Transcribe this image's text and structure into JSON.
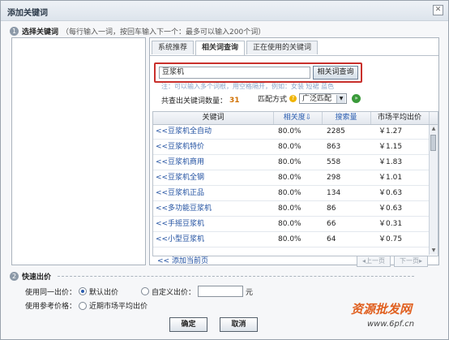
{
  "dialog": {
    "title": "添加关键词",
    "close_glyph": "✕"
  },
  "section1": {
    "number": "1",
    "title": "选择关键词",
    "note": "（每行输入一词，按回车输入下一个：最多可以输入200个词）"
  },
  "tabs": [
    {
      "label": "系统推荐"
    },
    {
      "label": "相关词查询"
    },
    {
      "label": "正在使用的关键词"
    }
  ],
  "search": {
    "value": "豆浆机",
    "button": "相关词查询"
  },
  "hint": "注：可以输入多个词根，用空格隔开，例如：女装  短裙  蓝色",
  "result": {
    "label": "共查出关键词数量：",
    "count": "31"
  },
  "match": {
    "label": "匹配方式",
    "help_glyph": "?",
    "selected": "广泛匹配",
    "go_glyph": "»"
  },
  "grid": {
    "headers": {
      "keyword": "关键词",
      "relevance": "相关度",
      "sort_glyph": "⇩",
      "searches": "搜索量",
      "price": "市场平均出价"
    },
    "rows": [
      {
        "kw": "豆浆机全自动",
        "rel": "80.0%",
        "sea": "2285",
        "price": "￥1.27"
      },
      {
        "kw": "豆浆机特价",
        "rel": "80.0%",
        "sea": "863",
        "price": "￥1.15"
      },
      {
        "kw": "豆浆机商用",
        "rel": "80.0%",
        "sea": "558",
        "price": "￥1.83"
      },
      {
        "kw": "豆浆机全钢",
        "rel": "80.0%",
        "sea": "298",
        "price": "￥1.01"
      },
      {
        "kw": "豆浆机正品",
        "rel": "80.0%",
        "sea": "134",
        "price": "￥0.63"
      },
      {
        "kw": "多功能豆浆机",
        "rel": "80.0%",
        "sea": "86",
        "price": "￥0.63"
      },
      {
        "kw": "手摇豆浆机",
        "rel": "80.0%",
        "sea": "66",
        "price": "￥0.31"
      },
      {
        "kw": "小型豆浆机",
        "rel": "80.0%",
        "sea": "64",
        "price": "￥0.75"
      }
    ],
    "add_glyph": "<<",
    "add_all": "添加当前页",
    "prev": "上一页",
    "next": "下一页"
  },
  "section2": {
    "number": "2",
    "title": "快速出价"
  },
  "bid": {
    "uniform_label": "使用同一出价：",
    "default_bid": "默认出价",
    "custom_bid": "自定义出价：",
    "unit": "元",
    "ref_label": "使用参考价格：",
    "recent_avg": "近期市场平均出价"
  },
  "buttons": {
    "ok": "确定",
    "cancel": "取消"
  },
  "watermark": {
    "brand": "资源批发网",
    "url": "www.6pf.cn"
  }
}
